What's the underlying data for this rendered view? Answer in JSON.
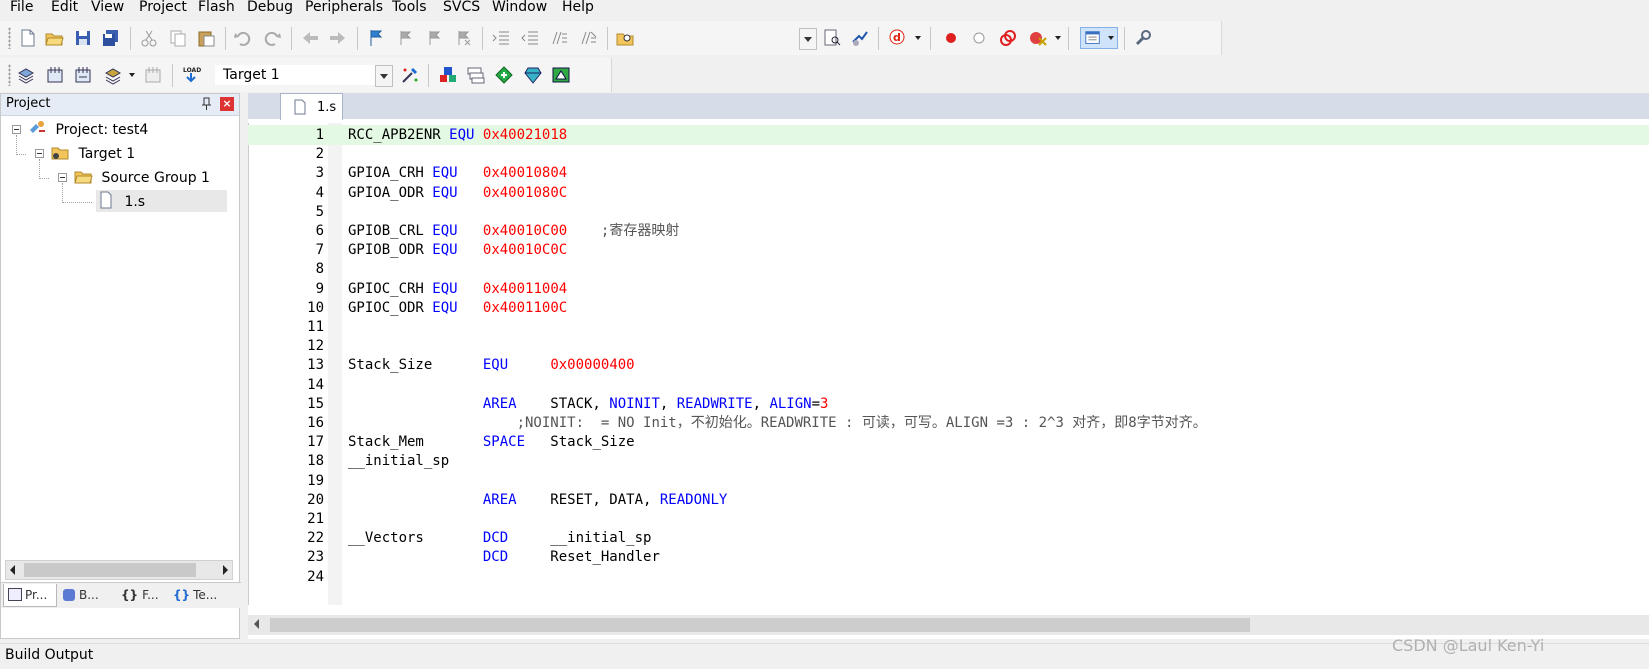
{
  "menu": [
    "File",
    "Edit",
    "View",
    "Project",
    "Flash",
    "Debug",
    "Peripherals",
    "Tools",
    "SVCS",
    "Window",
    "Help"
  ],
  "toolbar2": {
    "target_select": "Target 1"
  },
  "project_panel": {
    "title": "Project",
    "tree": {
      "project": "Project: test4",
      "target": "Target 1",
      "group": "Source Group 1",
      "file": "1.s"
    },
    "tabs": [
      "Pr...",
      "B...",
      "F...",
      "Te..."
    ]
  },
  "editor": {
    "tab_label": "1.s",
    "lines": [
      {
        "n": "1",
        "t": "RCC_APB2ENR EQU 0x40021018"
      },
      {
        "n": "2",
        "t": ""
      },
      {
        "n": "3",
        "t": "GPIOA_CRH EQU   0x40010804"
      },
      {
        "n": "4",
        "t": "GPIOA_ODR EQU   0x4001080C"
      },
      {
        "n": "5",
        "t": ""
      },
      {
        "n": "6",
        "t": "GPIOB_CRL EQU   0x40010C00    ;寄存器映射"
      },
      {
        "n": "7",
        "t": "GPIOB_ODR EQU   0x40010C0C"
      },
      {
        "n": "8",
        "t": ""
      },
      {
        "n": "9",
        "t": "GPIOC_CRH EQU   0x40011004"
      },
      {
        "n": "10",
        "t": "GPIOC_ODR EQU   0x4001100C"
      },
      {
        "n": "11",
        "t": ""
      },
      {
        "n": "12",
        "t": ""
      },
      {
        "n": "13",
        "t": "Stack_Size      EQU     0x00000400"
      },
      {
        "n": "14",
        "t": ""
      },
      {
        "n": "15",
        "t": "                AREA    STACK, NOINIT, READWRITE, ALIGN=3"
      },
      {
        "n": "16",
        "t": "                    ;NOINIT:  = NO Init，不初始化。READWRITE : 可读，可写。ALIGN =3 : 2^3 对齐，即8字节对齐。"
      },
      {
        "n": "17",
        "t": "Stack_Mem       SPACE   Stack_Size"
      },
      {
        "n": "18",
        "t": "__initial_sp"
      },
      {
        "n": "19",
        "t": ""
      },
      {
        "n": "20",
        "t": "                AREA    RESET, DATA, READONLY"
      },
      {
        "n": "21",
        "t": ""
      },
      {
        "n": "22",
        "t": "__Vectors       DCD     __initial_sp"
      },
      {
        "n": "23",
        "t": "                DCD     Reset_Handler"
      },
      {
        "n": "24",
        "t": ""
      }
    ]
  },
  "status": {
    "build_output": "Build Output"
  },
  "watermark": "CSDN @Laul Ken-Yi",
  "colors": {
    "keyword": "#0000ff",
    "number": "#ff0000",
    "current_line": "#e3f9e3"
  }
}
